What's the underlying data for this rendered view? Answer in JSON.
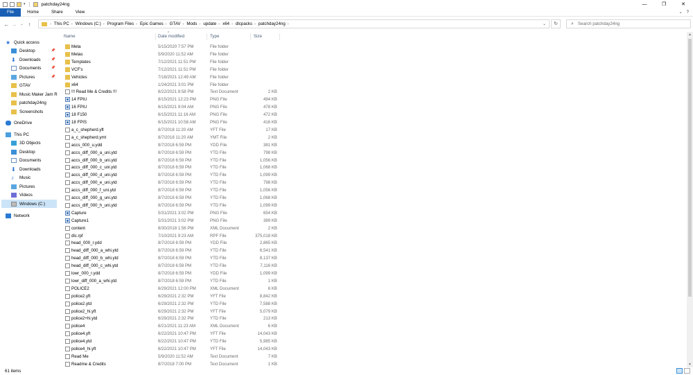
{
  "window": {
    "title": "patchday24ng"
  },
  "ribbon": {
    "tabs": [
      "File",
      "Home",
      "Share",
      "View"
    ]
  },
  "address": {
    "crumbs": [
      "This PC",
      "Windows (C:)",
      "Program Files",
      "Epic Games",
      "GTAV",
      "Mods",
      "update",
      "x64",
      "dlcpacks",
      "patchday24ng"
    ],
    "search_placeholder": "Search patchday24ng"
  },
  "nav": {
    "items": [
      {
        "label": "Quick access",
        "icon": "star-icon",
        "pinned": false
      },
      {
        "label": "Desktop",
        "icon": "desktop-icon",
        "pinned": true
      },
      {
        "label": "Downloads",
        "icon": "download-icon",
        "pinned": true
      },
      {
        "label": "Documents",
        "icon": "documents-icon",
        "pinned": true
      },
      {
        "label": "Pictures",
        "icon": "pictures-icon",
        "pinned": true
      },
      {
        "label": "GTAV",
        "icon": "folder-icon",
        "pinned": false
      },
      {
        "label": "Music Maker Jam R",
        "icon": "folder-icon",
        "pinned": false
      },
      {
        "label": "patchday24ng",
        "icon": "folder-icon",
        "pinned": false
      },
      {
        "label": "Screenshots",
        "icon": "folder-icon",
        "pinned": false
      },
      {
        "label": "OneDrive",
        "icon": "cloud-icon",
        "pinned": false
      },
      {
        "label": "This PC",
        "icon": "computer-icon",
        "pinned": false
      },
      {
        "label": "3D Objects",
        "icon": "3d-objects-icon",
        "pinned": false
      },
      {
        "label": "Desktop",
        "icon": "desktop-icon",
        "pinned": false
      },
      {
        "label": "Documents",
        "icon": "documents-icon",
        "pinned": false
      },
      {
        "label": "Downloads",
        "icon": "download-icon",
        "pinned": false
      },
      {
        "label": "Music",
        "icon": "music-icon",
        "pinned": false
      },
      {
        "label": "Pictures",
        "icon": "pictures-icon",
        "pinned": false
      },
      {
        "label": "Videos",
        "icon": "videos-icon",
        "pinned": false
      },
      {
        "label": "Windows (C:)",
        "icon": "drive-icon",
        "pinned": false,
        "selected": true
      },
      {
        "label": "Network",
        "icon": "network-icon",
        "pinned": false
      }
    ]
  },
  "columns": {
    "name": "Name",
    "date": "Date modified",
    "type": "Type",
    "size": "Size"
  },
  "files": [
    {
      "name": "Meta",
      "date": "5/15/2020 7:57 PM",
      "type": "File folder",
      "size": "",
      "kind": "folder"
    },
    {
      "name": "Metas",
      "date": "5/9/2020 11:52 AM",
      "type": "File folder",
      "size": "",
      "kind": "folder"
    },
    {
      "name": "Templates",
      "date": "7/12/2021 11:51 PM",
      "type": "File folder",
      "size": "",
      "kind": "folder"
    },
    {
      "name": "VCF's",
      "date": "7/12/2021 11:51 PM",
      "type": "File folder",
      "size": "",
      "kind": "folder"
    },
    {
      "name": "Vehicles",
      "date": "7/18/2021 12:49 AM",
      "type": "File folder",
      "size": "",
      "kind": "folder"
    },
    {
      "name": "x64",
      "date": "1/24/2021 3:01 PM",
      "type": "File folder",
      "size": "",
      "kind": "folder"
    },
    {
      "name": "!!! Read Me & Credits !!!",
      "date": "6/22/2021 8:58 PM",
      "type": "Text Document",
      "size": "2 KB",
      "kind": "file"
    },
    {
      "name": "14 FPIU",
      "date": "8/15/2021 12:23 PM",
      "type": "PNG File",
      "size": "494 KB",
      "kind": "png"
    },
    {
      "name": "16 FPIU",
      "date": "6/15/2021 9:04 AM",
      "type": "PNG File",
      "size": "478 KB",
      "kind": "png"
    },
    {
      "name": "18 F150",
      "date": "6/15/2021 11:16 AM",
      "type": "PNG File",
      "size": "472 KB",
      "kind": "png"
    },
    {
      "name": "18 FPIS",
      "date": "6/15/2021 10:58 AM",
      "type": "PNG File",
      "size": "416 KB",
      "kind": "png"
    },
    {
      "name": "a_c_shepherd.yft",
      "date": "8/7/2018 11:20 AM",
      "type": "YFT File",
      "size": "17 KB",
      "kind": "file"
    },
    {
      "name": "a_c_shepherd.ymt",
      "date": "8/7/2018 11:20 AM",
      "type": "YMT File",
      "size": "2 KB",
      "kind": "file"
    },
    {
      "name": "accs_000_u.ydd",
      "date": "8/7/2018 6:59 PM",
      "type": "YDD File",
      "size": "381 KB",
      "kind": "file"
    },
    {
      "name": "accs_diff_000_a_uni.ytd",
      "date": "8/7/2018 6:59 PM",
      "type": "YTD File",
      "size": "798 KB",
      "kind": "file"
    },
    {
      "name": "accs_diff_000_b_uni.ytd",
      "date": "8/7/2018 6:59 PM",
      "type": "YTD File",
      "size": "1,056 KB",
      "kind": "file"
    },
    {
      "name": "accs_diff_000_c_uni.ytd",
      "date": "8/7/2018 6:59 PM",
      "type": "YTD File",
      "size": "1,068 KB",
      "kind": "file"
    },
    {
      "name": "accs_diff_000_d_uni.ytd",
      "date": "8/7/2018 6:59 PM",
      "type": "YTD File",
      "size": "1,099 KB",
      "kind": "file"
    },
    {
      "name": "accs_diff_000_e_uni.ytd",
      "date": "8/7/2018 6:59 PM",
      "type": "YTD File",
      "size": "798 KB",
      "kind": "file"
    },
    {
      "name": "accs_diff_000_f_uni.ytd",
      "date": "8/7/2018 6:59 PM",
      "type": "YTD File",
      "size": "1,056 KB",
      "kind": "file"
    },
    {
      "name": "accs_diff_000_g_uni.ytd",
      "date": "8/7/2018 6:59 PM",
      "type": "YTD File",
      "size": "1,068 KB",
      "kind": "file"
    },
    {
      "name": "accs_diff_000_h_uni.ytd",
      "date": "8/7/2018 6:59 PM",
      "type": "YTD File",
      "size": "1,099 KB",
      "kind": "file"
    },
    {
      "name": "Capture",
      "date": "5/31/2021 3:02 PM",
      "type": "PNG File",
      "size": "654 KB",
      "kind": "png"
    },
    {
      "name": "Capture1",
      "date": "5/31/2021 3:02 PM",
      "type": "PNG File",
      "size": "389 KB",
      "kind": "png"
    },
    {
      "name": "content",
      "date": "8/30/2018 1:56 PM",
      "type": "XML Document",
      "size": "2 KB",
      "kind": "file"
    },
    {
      "name": "dlc.rpf",
      "date": "7/10/2021 9:23 AM",
      "type": "RPF File",
      "size": "375,018 KB",
      "kind": "file"
    },
    {
      "name": "head_000_r.ydd",
      "date": "8/7/2018 6:59 PM",
      "type": "YDD File",
      "size": "2,865 KB",
      "kind": "file"
    },
    {
      "name": "head_diff_000_a_whi.ytd",
      "date": "8/7/2018 6:59 PM",
      "type": "YTD File",
      "size": "6,541 KB",
      "kind": "file"
    },
    {
      "name": "head_diff_000_b_whi.ytd",
      "date": "8/7/2018 6:59 PM",
      "type": "YTD File",
      "size": "8,137 KB",
      "kind": "file"
    },
    {
      "name": "head_diff_000_c_whi.ytd",
      "date": "8/7/2018 6:59 PM",
      "type": "YTD File",
      "size": "7,116 KB",
      "kind": "file"
    },
    {
      "name": "lowr_000_r.ydd",
      "date": "8/7/2018 6:59 PM",
      "type": "YDD File",
      "size": "1,099 KB",
      "kind": "file"
    },
    {
      "name": "lowr_diff_000_a_whi.ytd",
      "date": "8/7/2018 6:59 PM",
      "type": "YTD File",
      "size": "1 KB",
      "kind": "file"
    },
    {
      "name": "POLICE2",
      "date": "6/29/2021 12:00 PM",
      "type": "XML Document",
      "size": "6 KB",
      "kind": "file"
    },
    {
      "name": "police2.yft",
      "date": "6/29/2021 2:32 PM",
      "type": "YFT File",
      "size": "8,842 KB",
      "kind": "file"
    },
    {
      "name": "police2.ytd",
      "date": "6/29/2021 2:32 PM",
      "type": "YTD File",
      "size": "7,588 KB",
      "kind": "file"
    },
    {
      "name": "police2_hi.yft",
      "date": "6/29/2021 2:32 PM",
      "type": "YFT File",
      "size": "5,079 KB",
      "kind": "file"
    },
    {
      "name": "police2+hi.ytd",
      "date": "6/29/2021 2:32 PM",
      "type": "YTD File",
      "size": "213 KB",
      "kind": "file"
    },
    {
      "name": "police4",
      "date": "6/21/2021 11:23 AM",
      "type": "XML Document",
      "size": "6 KB",
      "kind": "file"
    },
    {
      "name": "police4.yft",
      "date": "6/22/2021 10:47 PM",
      "type": "YFT File",
      "size": "14,043 KB",
      "kind": "file"
    },
    {
      "name": "police4.ytd",
      "date": "6/22/2021 10:47 PM",
      "type": "YTD File",
      "size": "5,985 KB",
      "kind": "file"
    },
    {
      "name": "police4_hi.yft",
      "date": "6/22/2021 10:47 PM",
      "type": "YFT File",
      "size": "14,043 KB",
      "kind": "file"
    },
    {
      "name": "Read Me",
      "date": "5/9/2020 11:52 AM",
      "type": "Text Document",
      "size": "7 KB",
      "kind": "file"
    },
    {
      "name": "Readme & Credits",
      "date": "8/7/2018 7:00 PM",
      "type": "Text Document",
      "size": "1 KB",
      "kind": "file"
    }
  ],
  "status": {
    "count": "61 items"
  },
  "colors": {
    "accent": "#1a5fb4",
    "selection": "#cce4f7",
    "folder": "#e8c04a"
  }
}
